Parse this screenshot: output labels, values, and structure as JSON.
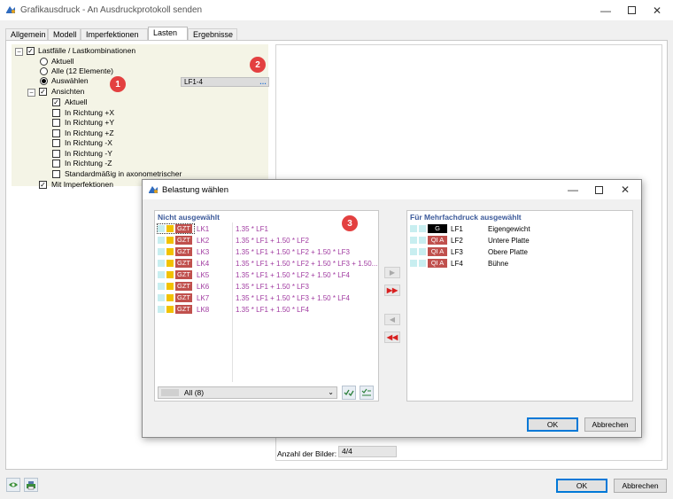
{
  "window": {
    "title": "Grafikausdruck - An Ausdruckprotokoll senden",
    "tabs": [
      "Allgemein",
      "Modell",
      "Imperfektionen",
      "Lasten",
      "Ergebnisse"
    ]
  },
  "tree": {
    "root": "Lastfälle / Lastkombinationen",
    "options": [
      "Aktuell",
      "Alle (12 Elemente)",
      "Auswählen"
    ],
    "selected_value": "LF1-4",
    "views_label": "Ansichten",
    "views": [
      "Aktuell",
      "In Richtung +X",
      "In Richtung +Y",
      "In Richtung +Z",
      "In Richtung -X",
      "In Richtung -Y",
      "In Richtung -Z",
      "Standardmäßig in axonometrischer"
    ],
    "views_checked": [
      true,
      false,
      false,
      false,
      false,
      false,
      false,
      false
    ],
    "imperfections_label": "Mit Imperfektionen"
  },
  "markers": [
    "1",
    "2",
    "3"
  ],
  "footer": {
    "image_count_label": "Anzahl der Bilder:",
    "image_count": "4/4",
    "ok": "OK",
    "cancel": "Abbrechen"
  },
  "dialog": {
    "title": "Belastung wählen",
    "left_header": "Nicht ausgewählt",
    "right_header": "Für Mehrfachdruck ausgewählt",
    "left_rows": [
      {
        "tag": "GZT",
        "id": "LK1",
        "formula": "1.35 * LF1"
      },
      {
        "tag": "GZT",
        "id": "LK2",
        "formula": "1.35 * LF1 + 1.50 * LF2"
      },
      {
        "tag": "GZT",
        "id": "LK3",
        "formula": "1.35 * LF1 + 1.50 * LF2 + 1.50 * LF3"
      },
      {
        "tag": "GZT",
        "id": "LK4",
        "formula": "1.35 * LF1 + 1.50 * LF2 + 1.50 * LF3 + 1.50..."
      },
      {
        "tag": "GZT",
        "id": "LK5",
        "formula": "1.35 * LF1 + 1.50 * LF2 + 1.50 * LF4"
      },
      {
        "tag": "GZT",
        "id": "LK6",
        "formula": "1.35 * LF1 + 1.50 * LF3"
      },
      {
        "tag": "GZT",
        "id": "LK7",
        "formula": "1.35 * LF1 + 1.50 * LF3 + 1.50 * LF4"
      },
      {
        "tag": "GZT",
        "id": "LK8",
        "formula": "1.35 * LF1 + 1.50 * LF4"
      }
    ],
    "right_rows": [
      {
        "tag": "G",
        "id": "LF1",
        "name": "Eigengewicht"
      },
      {
        "tag": "QI A",
        "id": "LF2",
        "name": "Untere Platte"
      },
      {
        "tag": "QI A",
        "id": "LF3",
        "name": "Obere Platte"
      },
      {
        "tag": "QI A",
        "id": "LF4",
        "name": "Bühne"
      }
    ],
    "filter_value": "All (8)",
    "ok": "OK",
    "cancel": "Abbrechen"
  },
  "colors": {
    "tag_red": "#c0504d",
    "formula_purple": "#a03aa0",
    "header_blue": "#3c5a9a",
    "marker_red": "#e34040",
    "accent_blue": "#0078d7"
  }
}
